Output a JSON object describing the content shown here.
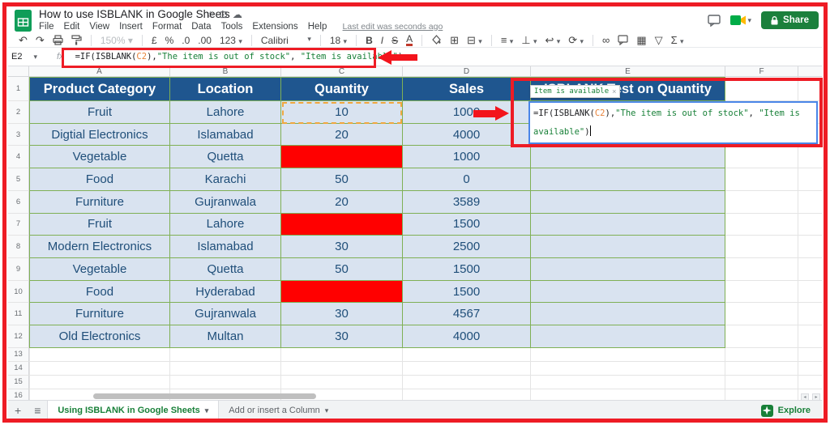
{
  "window": {
    "app": "Google Sheets",
    "title": "How to use ISBLANK in Google Sheets"
  },
  "titlebar": {
    "last_edit": "Last edit was seconds ago",
    "share": "Share"
  },
  "menubar": {
    "items": [
      "File",
      "Edit",
      "View",
      "Insert",
      "Format",
      "Data",
      "Tools",
      "Extensions",
      "Help"
    ]
  },
  "toolbar": {
    "undo": "↶",
    "redo": "↷",
    "zoom": "150%",
    "currency": "£",
    "percent": "%",
    "decrease_decimal": ".0",
    "increase_decimal": ".00",
    "more_formats": "123",
    "font": "Calibri",
    "font_size": "18",
    "bold": "B",
    "italic": "I",
    "strikethrough": "S",
    "text_color": "A",
    "borders": "⊞",
    "merge_cells": "⊟",
    "horizontal_align": "≡",
    "vertical_align": "⊥",
    "text_wrap": "↩",
    "text_rotation": "⟳",
    "insert_link": "∞",
    "insert_chart": "▦",
    "create_filter": "▽",
    "functions": "Σ",
    "dropdown": "▾"
  },
  "formula_bar": {
    "name_box": "E2",
    "fx_label": "fx",
    "parts": [
      {
        "t": "=IF(ISBLANK(",
        "c": "def"
      },
      {
        "t": "C2",
        "c": "ref"
      },
      {
        "t": "),",
        "c": "def"
      },
      {
        "t": "\"The item is out of stock\"",
        "c": "str"
      },
      {
        "t": ", ",
        "c": "def"
      },
      {
        "t": "\"Item is available\"",
        "c": "str"
      },
      {
        "t": ")",
        "c": "def"
      }
    ]
  },
  "sheet": {
    "col_letters": [
      "A",
      "B",
      "C",
      "D",
      "E",
      "F"
    ],
    "header_cells": {
      "a": "Product Category",
      "b": "Location",
      "c": "Quantity",
      "d": "Sales",
      "e": "ISBLANK Test on Quantity"
    },
    "rows": [
      {
        "n": "2",
        "category": "Fruit",
        "location": "Lahore",
        "quantity": "10",
        "sales": "1000",
        "qty_red": false
      },
      {
        "n": "3",
        "category": "Digtial Electronics",
        "location": "Islamabad",
        "quantity": "20",
        "sales": "4000",
        "qty_red": false
      },
      {
        "n": "4",
        "category": "Vegetable",
        "location": "Quetta",
        "quantity": "",
        "sales": "1000",
        "qty_red": true
      },
      {
        "n": "5",
        "category": "Food",
        "location": "Karachi",
        "quantity": "50",
        "sales": "0",
        "qty_red": false
      },
      {
        "n": "6",
        "category": "Furniture",
        "location": "Gujranwala",
        "quantity": "20",
        "sales": "3589",
        "qty_red": false
      },
      {
        "n": "7",
        "category": "Fruit",
        "location": "Lahore",
        "quantity": "",
        "sales": "1500",
        "qty_red": true
      },
      {
        "n": "8",
        "category": "Modern Electronics",
        "location": "Islamabad",
        "quantity": "30",
        "sales": "2500",
        "qty_red": false
      },
      {
        "n": "9",
        "category": "Vegetable",
        "location": "Quetta",
        "quantity": "50",
        "sales": "1500",
        "qty_red": false
      },
      {
        "n": "10",
        "category": "Food",
        "location": "Hyderabad",
        "quantity": "",
        "sales": "1500",
        "qty_red": true
      },
      {
        "n": "11",
        "category": "Furniture",
        "location": "Gujranwala",
        "quantity": "30",
        "sales": "4567",
        "qty_red": false
      },
      {
        "n": "12",
        "category": "Old Electronics",
        "location": "Multan",
        "quantity": "30",
        "sales": "4000",
        "qty_red": false
      }
    ],
    "empty_rows": [
      "13",
      "14",
      "15",
      "16"
    ]
  },
  "cell_editor": {
    "line1": [
      {
        "t": "=IF(ISBLANK(",
        "c": "def"
      },
      {
        "t": "C2",
        "c": "ref"
      },
      {
        "t": "),",
        "c": "def"
      },
      {
        "t": "\"The item is out of stock\"",
        "c": "str"
      },
      {
        "t": ", ",
        "c": "def"
      },
      {
        "t": "\"Item is",
        "c": "str"
      }
    ],
    "line2": [
      {
        "t": "available\"",
        "c": "str"
      },
      {
        "t": ")",
        "c": "def"
      }
    ]
  },
  "tooltip": {
    "text": "Item is available",
    "close": "×"
  },
  "sheet_tabs": {
    "add": "+",
    "all_sheets": "≡",
    "tabs": [
      {
        "label": "Using ISBLANK in Google Sheets",
        "active": true
      },
      {
        "label": "Add or insert a Column",
        "active": false
      }
    ],
    "explore": "Explore"
  },
  "colors": {
    "header-blue": "#1F568F",
    "cell-blue": "#D9E3F0",
    "border-green": "#7FB055",
    "text-navy": "#1F4E79",
    "red-cell": "#FF0000",
    "annotation-red": "#EE1C25",
    "formula-string-green": "#188038",
    "formula-ref-orange": "#E8833A",
    "share-green": "#1B803C",
    "tab-green": "#188038",
    "logo-green": "#0F9D58"
  }
}
